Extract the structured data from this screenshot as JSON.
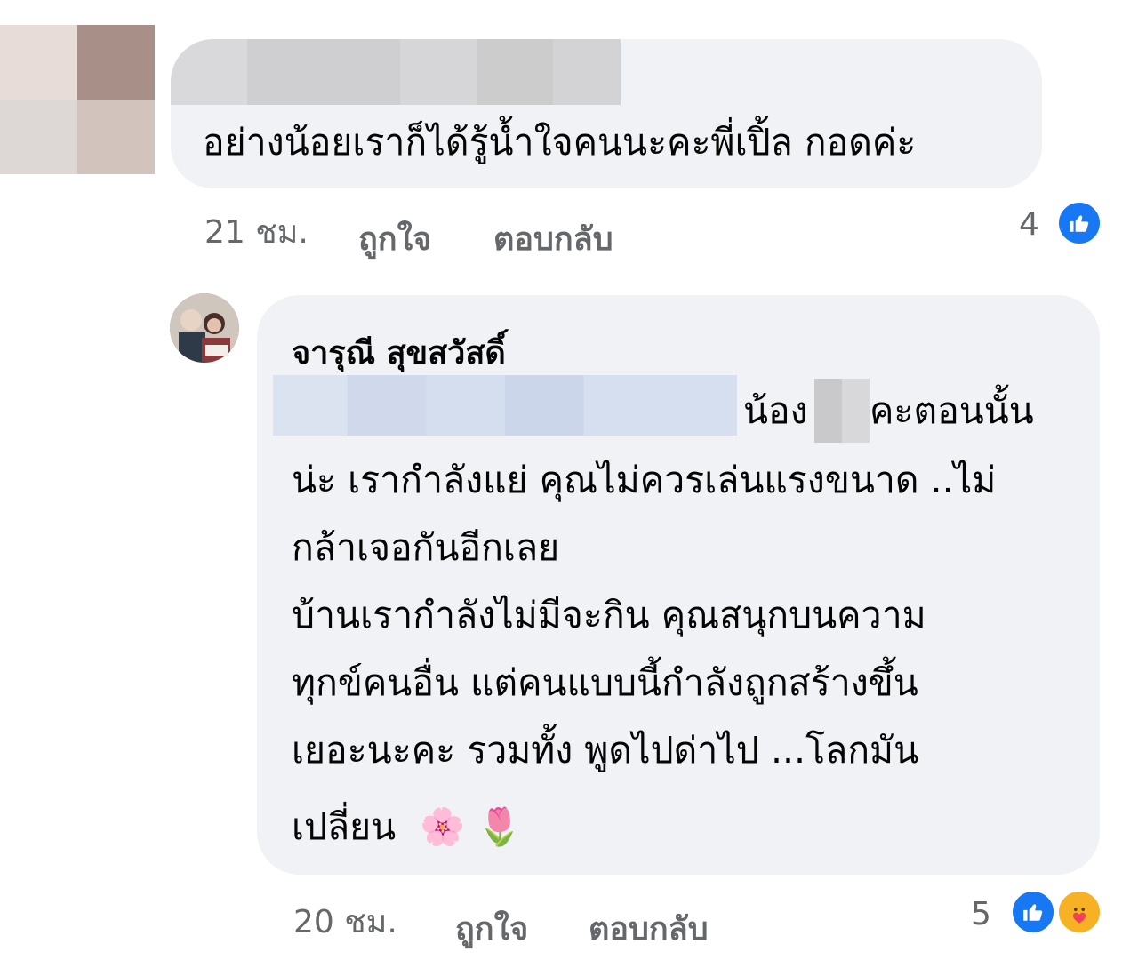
{
  "comment1": {
    "text": "อย่างน้อยเราก็ได้รู้น้ำใจคนนะคะพี่เปิ้ล กอดค่ะ",
    "time": "21 ชม.",
    "like_label": "ถูกใจ",
    "reply_label": "ตอบกลับ",
    "reaction_count": "4",
    "reactions": [
      "like-icon"
    ]
  },
  "comment2": {
    "author": "จารุณี สุขสวัสดิ์",
    "line1_pre": "น้อง",
    "line1_post": "คะตอนนั้น",
    "line2": "น่ะ เรากำลังแย่ คุณไม่ควรเล่นแรงขนาด ..ไม่",
    "line3": "กล้าเจอกันอีกเลย",
    "line4": "บ้านเรากำลังไม่มีจะกิน คุณสนุกบนความ",
    "line5": "ทุกข์คนอื่น แต่คนแบบนี้กำลังถูกสร้างขึ้น",
    "line6": "เยอะนะคะ รวมทั้ง พูดไปด่าไป ...โลกมัน",
    "line7": "เปลี่ยน",
    "emojis": [
      "🌸",
      "🌷"
    ],
    "time": "20 ชม.",
    "like_label": "ถูกใจ",
    "reply_label": "ตอบกลับ",
    "reaction_count": "5",
    "reactions": [
      "like-icon",
      "care-icon"
    ]
  },
  "colors": {
    "bubble": "#f0f2f5",
    "meta_text": "#65676b",
    "like_blue": "#1877f2",
    "care_yellow": "#f7b125"
  }
}
